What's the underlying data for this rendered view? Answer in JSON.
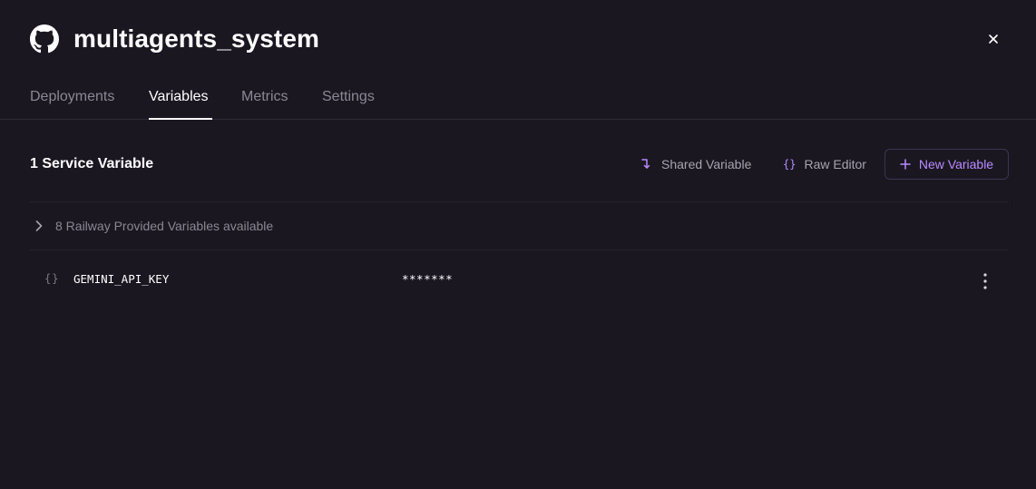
{
  "header": {
    "title": "multiagents_system",
    "icon": "github-icon",
    "close_icon": "close-icon"
  },
  "tabs": [
    {
      "label": "Deployments",
      "active": false
    },
    {
      "label": "Variables",
      "active": true
    },
    {
      "label": "Metrics",
      "active": false
    },
    {
      "label": "Settings",
      "active": false
    }
  ],
  "variables": {
    "section_title": "1 Service Variable",
    "actions": {
      "shared_label": "Shared Variable",
      "raw_editor_label": "Raw Editor",
      "new_variable_label": "New Variable"
    },
    "railway_provided": "8 Railway Provided Variables available",
    "items": [
      {
        "name": "GEMINI_API_KEY",
        "value": "*******"
      }
    ]
  },
  "colors": {
    "background": "#1a1721",
    "accent": "#b98bff",
    "muted_text": "#8b8794"
  }
}
